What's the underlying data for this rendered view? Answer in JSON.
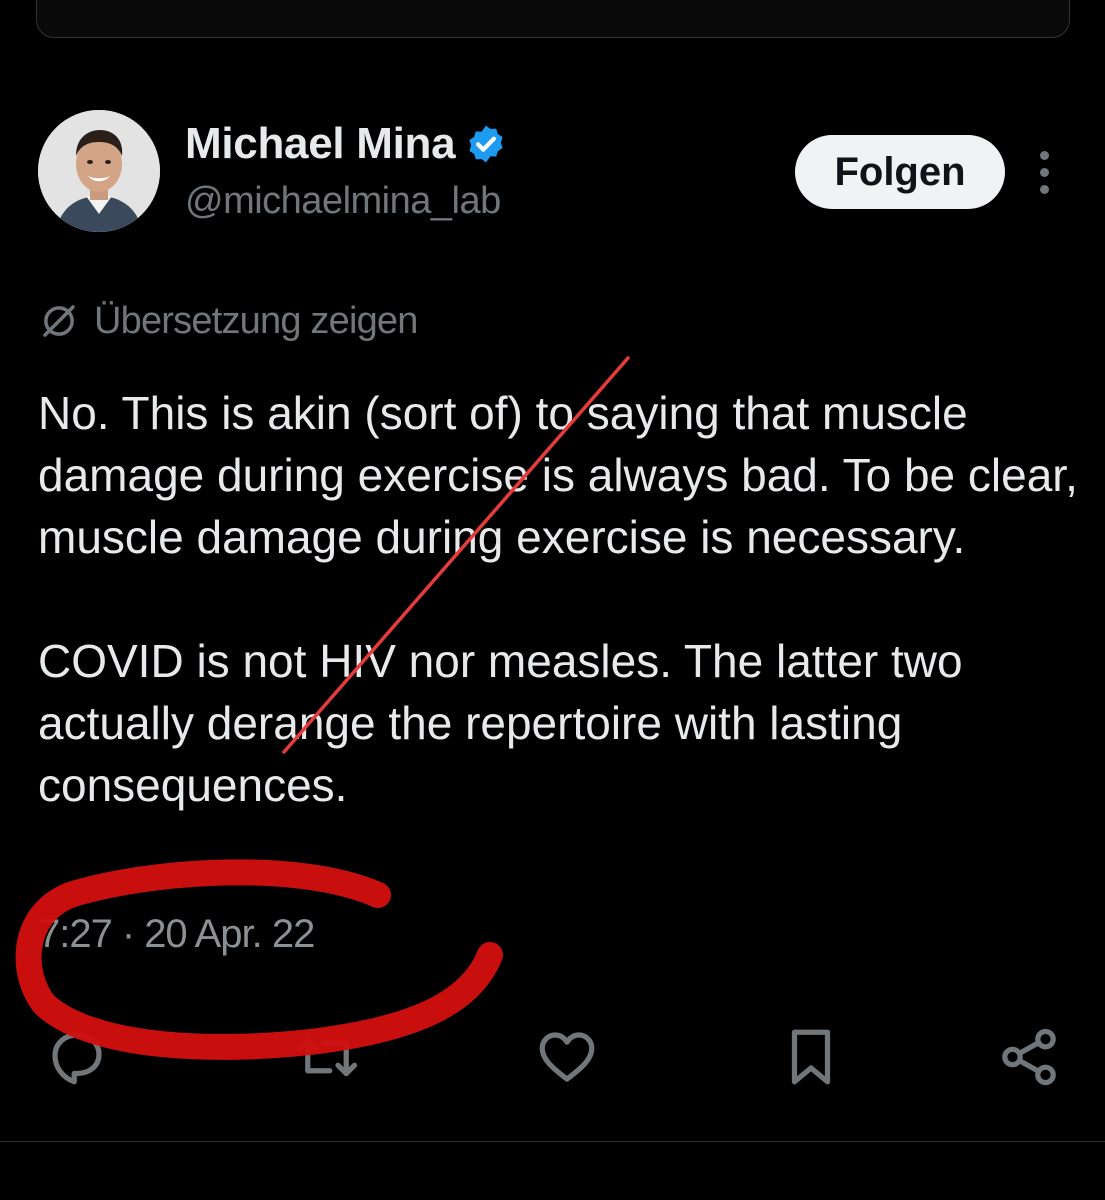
{
  "author": {
    "display_name": "Michael Mina",
    "handle": "@michaelmina_lab",
    "verified_icon": "verified-badge-icon",
    "verified_color": "#1d9bf0"
  },
  "follow_button": {
    "label": "Folgen"
  },
  "more_menu": {
    "icon": "more-vertical-icon"
  },
  "translation": {
    "icon": "translate-icon",
    "label": "Übersetzung zeigen"
  },
  "tweet": {
    "paragraphs": [
      "No. This is akin (sort of) to saying that muscle damage during exercise is always bad. To be clear, muscle damage during exercise is necessary.",
      "COVID is not HIV nor measles. The latter two actually derange the repertoire with lasting consequences."
    ],
    "time": "7:27",
    "separator": "·",
    "date": "20 Apr. 22"
  },
  "actions": [
    {
      "name": "reply",
      "icon": "reply-icon"
    },
    {
      "name": "retweet",
      "icon": "retweet-icon"
    },
    {
      "name": "like",
      "icon": "heart-icon"
    },
    {
      "name": "bookmark",
      "icon": "bookmark-icon"
    },
    {
      "name": "share",
      "icon": "share-icon"
    }
  ],
  "annotations": {
    "strike_line_color": "#e63b3b",
    "circle_color": "#d10f0f"
  },
  "colors": {
    "background": "#000000",
    "text_primary": "#e7e9ea",
    "text_secondary": "#71767b",
    "follow_bg": "#eff3f4"
  }
}
